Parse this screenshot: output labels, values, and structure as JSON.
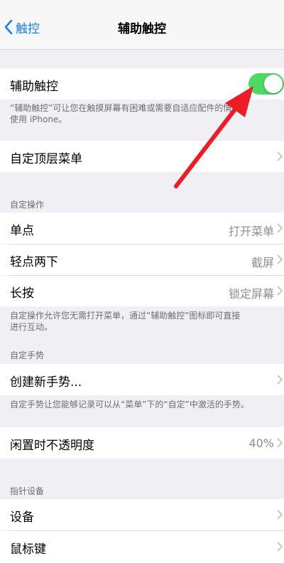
{
  "nav": {
    "back_label": "触控",
    "title": "辅助触控"
  },
  "assistive_touch": {
    "label": "辅助触控",
    "enabled": true,
    "description_line1": "“辅助触控”可让您在触摸屏幕有困难或需要自适应配件的情况下",
    "description_line2": "使用 iPhone。"
  },
  "customize_menu": {
    "label": "自定顶层菜单"
  },
  "custom_actions": {
    "header": "自定操作",
    "items": [
      {
        "label": "单点",
        "value": "打开菜单"
      },
      {
        "label": "轻点两下",
        "value": "截屏"
      },
      {
        "label": "长按",
        "value": "锁定屏幕"
      }
    ],
    "footnote_line1": "自定操作允许您无需打开菜单，通过“辅助触控”图标即可直接",
    "footnote_line2": "进行互动。"
  },
  "custom_gestures": {
    "header": "自定手势",
    "create_label": "创建新手势...",
    "footnote": "自定手势让您能够记录可以从“菜单”下的“自定”中激活的手势。"
  },
  "idle_opacity": {
    "label": "闲置时不透明度",
    "value": "40%"
  },
  "pointer_devices": {
    "header": "指针设备",
    "items": [
      {
        "label": "设备"
      },
      {
        "label": "鼠标键"
      }
    ]
  },
  "colors": {
    "accent": "#147efb",
    "toggle_on": "#4cd964",
    "arrow": "#ee1c25"
  }
}
